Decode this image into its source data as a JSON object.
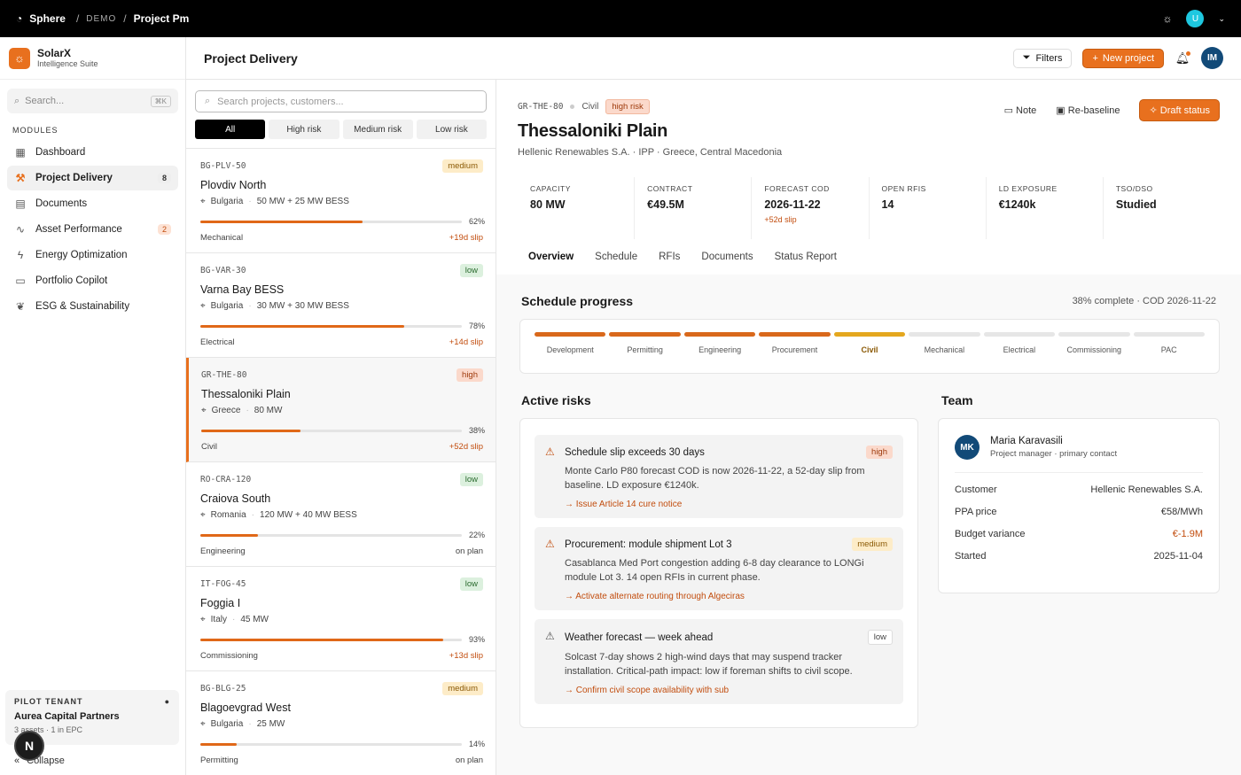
{
  "topbar": {
    "app": "Sphere",
    "crumb_demo": "DEMO",
    "crumb_current": "Project Pm",
    "user_initial": "U"
  },
  "sidebar": {
    "brand": "SolarX",
    "brand_sub": "Intelligence Suite",
    "search_placeholder": "Search...",
    "search_kbd": "⌘K",
    "modules_heading": "MODULES",
    "items": [
      {
        "label": "Dashboard",
        "icon": "grid-icon"
      },
      {
        "label": "Project Delivery",
        "icon": "hammer-icon",
        "badge": "8"
      },
      {
        "label": "Documents",
        "icon": "document-icon"
      },
      {
        "label": "Asset Performance",
        "icon": "pulse-icon",
        "badge": "2"
      },
      {
        "label": "Energy Optimization",
        "icon": "bolt-icon"
      },
      {
        "label": "Portfolio Copilot",
        "icon": "chat-icon"
      },
      {
        "label": "ESG & Sustainability",
        "icon": "leaf-icon"
      }
    ],
    "tenant": {
      "heading": "PILOT TENANT",
      "name": "Aurea Capital Partners",
      "sub": "3 assets · 1 in EPC"
    },
    "collapse": "Collapse"
  },
  "header": {
    "title": "Project Delivery",
    "filters": "Filters",
    "new_project": "New project",
    "user_initials": "IM"
  },
  "list": {
    "search_placeholder": "Search projects, customers...",
    "filters": [
      "All",
      "High risk",
      "Medium risk",
      "Low risk"
    ],
    "projects": [
      {
        "code": "BG-PLV-50",
        "risk": "medium",
        "name": "Plovdiv North",
        "country": "Bulgaria",
        "size": "50 MW + 25 MW BESS",
        "progress": 62,
        "pct": "62%",
        "phase": "Mechanical",
        "slip": "+19d slip"
      },
      {
        "code": "BG-VAR-30",
        "risk": "low",
        "name": "Varna Bay BESS",
        "country": "Bulgaria",
        "size": "30 MW + 30 MW BESS",
        "progress": 78,
        "pct": "78%",
        "phase": "Electrical",
        "slip": "+14d slip"
      },
      {
        "code": "GR-THE-80",
        "risk": "high",
        "name": "Thessaloniki Plain",
        "country": "Greece",
        "size": "80 MW",
        "progress": 38,
        "pct": "38%",
        "phase": "Civil",
        "slip": "+52d slip"
      },
      {
        "code": "RO-CRA-120",
        "risk": "low",
        "name": "Craiova South",
        "country": "Romania",
        "size": "120 MW + 40 MW BESS",
        "progress": 22,
        "pct": "22%",
        "phase": "Engineering",
        "slip": "on plan"
      },
      {
        "code": "IT-FOG-45",
        "risk": "low",
        "name": "Foggia I",
        "country": "Italy",
        "size": "45 MW",
        "progress": 93,
        "pct": "93%",
        "phase": "Commissioning",
        "slip": "+13d slip"
      },
      {
        "code": "BG-BLG-25",
        "risk": "medium",
        "name": "Blagoevgrad West",
        "country": "Bulgaria",
        "size": "25 MW",
        "progress": 14,
        "pct": "14%",
        "phase": "Permitting",
        "slip": "on plan"
      }
    ]
  },
  "detail": {
    "code": "GR-THE-80",
    "phase": "Civil",
    "risk": "high risk",
    "title": "Thessaloniki Plain",
    "subtitle": "Hellenic Renewables S.A. · IPP · Greece, Central Macedonia",
    "actions": {
      "note": "Note",
      "rebaseline": "Re-baseline",
      "draft": "Draft status"
    },
    "kpis": [
      {
        "label": "CAPACITY",
        "value": "80 MW"
      },
      {
        "label": "CONTRACT",
        "value": "€49.5M"
      },
      {
        "label": "FORECAST COD",
        "value": "2026-11-22",
        "extra": "+52d slip"
      },
      {
        "label": "OPEN RFIS",
        "value": "14"
      },
      {
        "label": "LD EXPOSURE",
        "value": "€1240k"
      },
      {
        "label": "TSO/DSO",
        "value": "Studied"
      }
    ],
    "tabs": [
      "Overview",
      "Schedule",
      "RFIs",
      "Documents",
      "Status Report"
    ],
    "schedule": {
      "title": "Schedule progress",
      "summary": "38% complete · COD 2026-11-22",
      "phases": [
        {
          "name": "Development",
          "state": "done"
        },
        {
          "name": "Permitting",
          "state": "done"
        },
        {
          "name": "Engineering",
          "state": "done"
        },
        {
          "name": "Procurement",
          "state": "done"
        },
        {
          "name": "Civil",
          "state": "cur"
        },
        {
          "name": "Mechanical",
          "state": "todo"
        },
        {
          "name": "Electrical",
          "state": "todo"
        },
        {
          "name": "Commissioning",
          "state": "todo"
        },
        {
          "name": "PAC",
          "state": "todo"
        }
      ]
    },
    "risks_title": "Active risks",
    "risks": [
      {
        "title": "Schedule slip exceeds 30 days",
        "level": "high",
        "desc": "Monte Carlo P80 forecast COD is now 2026-11-22, a 52-day slip from baseline. LD exposure €1240k.",
        "action": "→ Issue Article 14 cure notice"
      },
      {
        "title": "Procurement: module shipment Lot 3",
        "level": "medium",
        "desc": "Casablanca Med Port congestion adding 6-8 day clearance to LONGi module Lot 3. 14 open RFIs in current phase.",
        "action": "→ Activate alternate routing through Algeciras"
      },
      {
        "title": "Weather forecast — week ahead",
        "level": "low",
        "desc": "Solcast 7-day shows 2 high-wind days that may suspend tracker installation. Critical-path impact: low if foreman shifts to civil scope.",
        "action": "→ Confirm civil scope availability with sub"
      }
    ],
    "team_title": "Team",
    "team": {
      "initials": "MK",
      "name": "Maria Karavasili",
      "role": "Project manager · primary contact",
      "rows": [
        {
          "k": "Customer",
          "v": "Hellenic Renewables S.A."
        },
        {
          "k": "PPA price",
          "v": "€58/MWh"
        },
        {
          "k": "Budget variance",
          "v": "€-1.9M"
        },
        {
          "k": "Started",
          "v": "2025-11-04"
        }
      ]
    }
  }
}
